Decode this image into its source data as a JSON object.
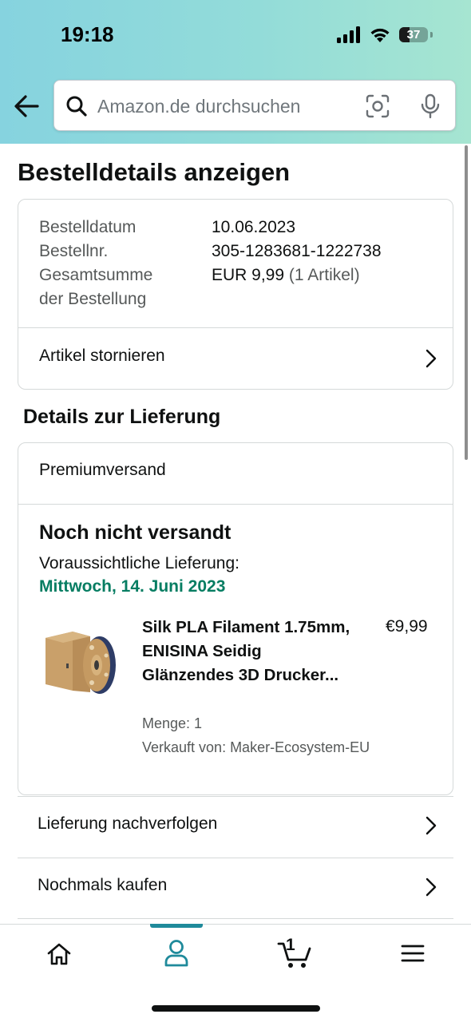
{
  "status_bar": {
    "time": "19:18",
    "battery": "37",
    "battery_level": 0.37
  },
  "header": {
    "search_placeholder": "Amazon.de durchsuchen",
    "gradient_colors": [
      "#86d3df",
      "#a6e5d1"
    ]
  },
  "page": {
    "title": "Bestelldetails anzeigen"
  },
  "order_summary": {
    "rows": [
      {
        "label": "Bestelldatum",
        "value": "10.06.2023"
      },
      {
        "label": "Bestellnr.",
        "value": "305-1283681-1222738"
      },
      {
        "label_line1": "Gesamtsumme",
        "label_line2": "der Bestellung",
        "value": "EUR 9,99",
        "value_suffix": "(1 Artikel)"
      }
    ],
    "cancel_link": "Artikel stornieren"
  },
  "delivery": {
    "section_title": "Details zur Lieferung",
    "shipping_type": "Premiumversand",
    "status": "Noch nicht versandt",
    "eta_label": "Voraussichtliche Lieferung:",
    "eta_date": "Mittwoch, 14. Juni 2023",
    "eta_color": "#067d62",
    "item": {
      "title": "Silk PLA Filament 1.75mm, ENISINA Seidig Glänzendes 3D Drucker...",
      "price": "€9,99",
      "quantity": "Menge: 1",
      "seller": "Verkauft von: Maker-Ecosystem-EU"
    }
  },
  "actions": [
    {
      "label": "Lieferung nachverfolgen"
    },
    {
      "label": "Nochmals kaufen"
    }
  ],
  "tabbar": {
    "active_tab": "profile",
    "active_color": "#1f8a9b",
    "cart_count": "1",
    "tabs": [
      {
        "icon": "home-icon"
      },
      {
        "icon": "profile-icon"
      },
      {
        "icon": "cart-icon"
      },
      {
        "icon": "menu-icon"
      }
    ]
  }
}
